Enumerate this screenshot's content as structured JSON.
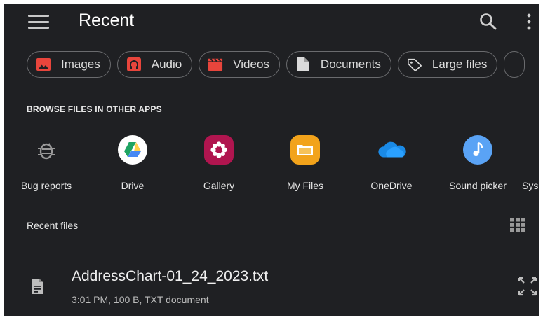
{
  "header": {
    "title": "Recent",
    "menu_icon": "hamburger-menu-icon",
    "search_icon": "search-icon",
    "more_icon": "more-vertical-icon"
  },
  "chips": [
    {
      "label": "Images",
      "icon": "image-icon",
      "color": "#e8453c"
    },
    {
      "label": "Audio",
      "icon": "headphones-icon",
      "color": "#e8453c"
    },
    {
      "label": "Videos",
      "icon": "clapperboard-icon",
      "color": "#e8453c"
    },
    {
      "label": "Documents",
      "icon": "document-icon",
      "color": "#dadada"
    },
    {
      "label": "Large files",
      "icon": "tag-icon",
      "color": "#dadada"
    }
  ],
  "browse": {
    "heading": "BROWSE FILES IN OTHER APPS",
    "apps": [
      {
        "label": "Bug reports",
        "icon": "bug-icon"
      },
      {
        "label": "Drive",
        "icon": "google-drive-icon"
      },
      {
        "label": "Gallery",
        "icon": "gallery-icon"
      },
      {
        "label": "My Files",
        "icon": "folder-icon"
      },
      {
        "label": "OneDrive",
        "icon": "cloud-icon"
      },
      {
        "label": "Sound picker",
        "icon": "music-note-icon"
      },
      {
        "label": "Sys",
        "icon": ""
      }
    ]
  },
  "recent": {
    "heading": "Recent files",
    "grid_icon": "grid-view-icon",
    "files": [
      {
        "name": "AddressChart-01_24_2023.txt",
        "meta": "3:01 PM, 100 B, TXT document",
        "icon": "text-file-icon",
        "action_icon": "expand-icon"
      }
    ]
  },
  "colors": {
    "background": "#1f2023",
    "chip_border": "#6a6b6e",
    "media_red": "#e8453c",
    "gallery_pink": "#b0154f",
    "myfiles_orange": "#f2a31b",
    "onedrive_blue": "#1a8ae6",
    "sound_blue": "#5aa3f5"
  }
}
